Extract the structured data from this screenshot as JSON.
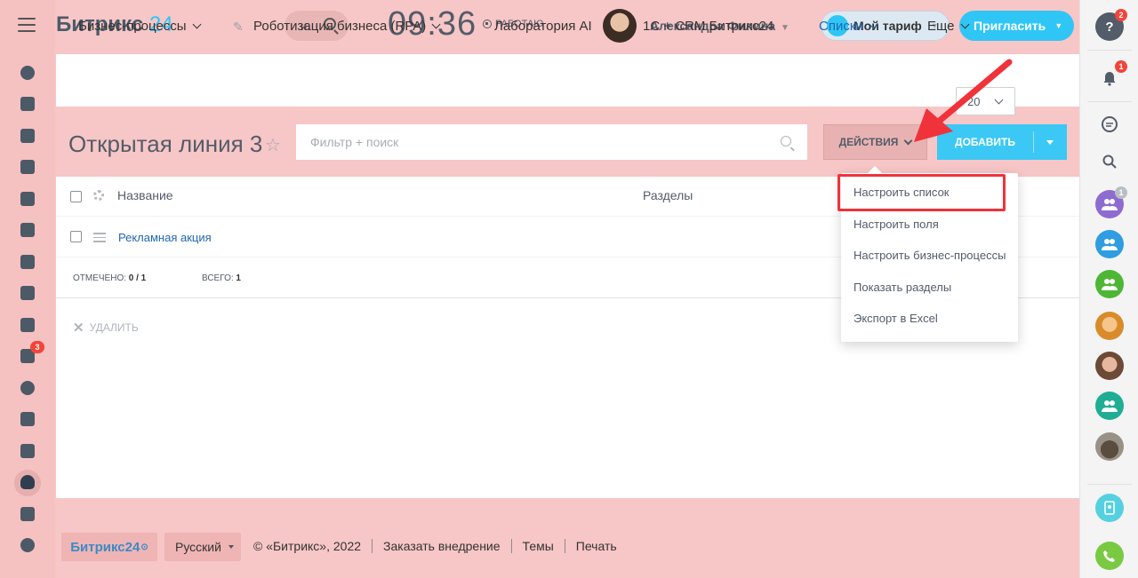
{
  "header": {
    "logo_text": "Битрикс",
    "logo_num": "24",
    "search_text": "и.",
    "clock": "09:36",
    "work_status": "РАБОТАЮ",
    "user_name": "Александра Филина",
    "tariff_label": "Мой тариф",
    "invite_label": "Пригласить"
  },
  "tabs": [
    {
      "label": "Бизнес-процессы"
    },
    {
      "label": "Роботизация бизнеса (RPA)"
    },
    {
      "label": "Лаборатория AI"
    },
    {
      "label": "1С + CRM Битрикс24"
    },
    {
      "label": "Списки"
    },
    {
      "label": "Еще"
    }
  ],
  "page": {
    "title": "Открытая линия 3",
    "filter_placeholder": "Фильтр + поиск",
    "actions_label": "ДЕЙСТВИЯ",
    "add_label": "ДОБАВИТЬ"
  },
  "grid": {
    "col_name": "Название",
    "col_sections": "Разделы",
    "rows": [
      {
        "name": "Рекламная акция"
      }
    ],
    "checked_label": "ОТМЕЧЕНО:",
    "checked_value": "0 / 1",
    "total_label": "ВСЕГО:",
    "total_value": "1",
    "page_size": "20",
    "delete_label": "УДАЛИТЬ"
  },
  "menu": {
    "items": [
      {
        "label": "Настроить список"
      },
      {
        "label": "Настроить поля"
      },
      {
        "label": "Настроить бизнес-процессы"
      },
      {
        "label": "Показать разделы"
      },
      {
        "label": "Экспорт в Excel"
      }
    ]
  },
  "left_sidebar": {
    "counter": "3"
  },
  "right_sidebar": {
    "help_count": "2",
    "notify_count": "1",
    "group_count": "1"
  },
  "footer": {
    "logo": "Битрикс24",
    "language": "Русский",
    "copyright": "© «Битрикс», 2022",
    "links": [
      "Заказать внедрение",
      "Темы",
      "Печать"
    ]
  },
  "colors": {
    "background": "#f7c6c6",
    "accent": "#2fc6f6",
    "link": "#2067b0",
    "highlight": "#f0323a"
  }
}
